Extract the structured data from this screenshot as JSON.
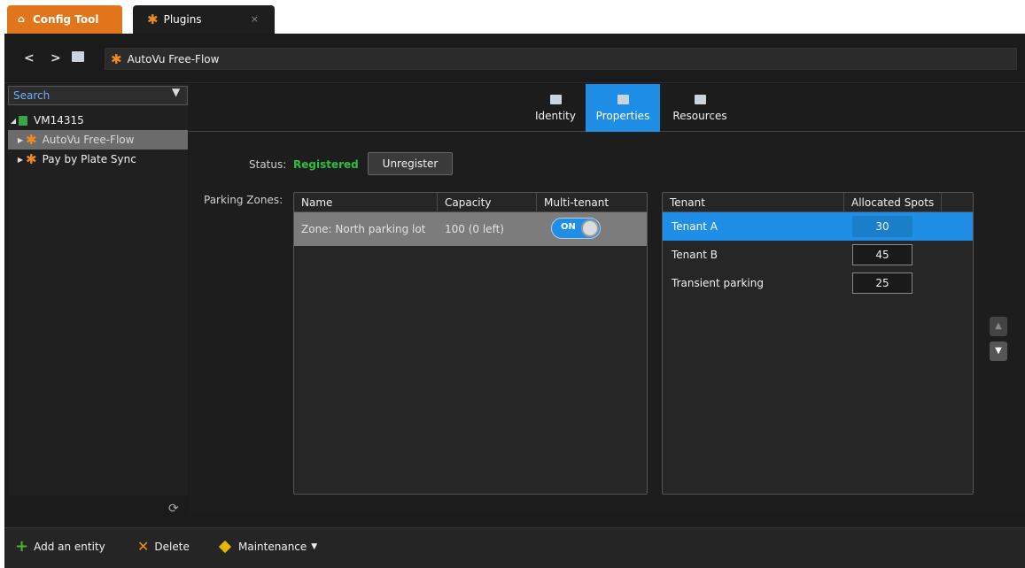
{
  "tabs": {
    "config_tool": "Config Tool",
    "plugins": "Plugins",
    "close": "×"
  },
  "nav": {
    "back": "<",
    "forward": ">",
    "address": "AutoVu Free-Flow"
  },
  "sidebar": {
    "search_placeholder": "Search",
    "tree": [
      {
        "label": "VM14315"
      },
      {
        "label": "AutoVu Free-Flow"
      },
      {
        "label": "Pay by Plate Sync"
      }
    ]
  },
  "content_tabs": [
    {
      "label": "Identity"
    },
    {
      "label": "Properties"
    },
    {
      "label": "Resources"
    }
  ],
  "status": {
    "label": "Status:",
    "value": "Registered",
    "unregister": "Unregister"
  },
  "parking": {
    "label": "Parking Zones:",
    "headers": [
      "Name",
      "Capacity",
      "Multi-tenant"
    ],
    "zone": {
      "name": "Zone: North parking lot",
      "capacity": "100 (0 left)",
      "multi_tenant": "ON"
    }
  },
  "tenants": {
    "headers": [
      "Tenant",
      "Allocated Spots"
    ],
    "rows": [
      {
        "name": "Tenant A",
        "spots": "30"
      },
      {
        "name": "Tenant B",
        "spots": "45"
      },
      {
        "name": "Transient parking",
        "spots": "25"
      }
    ]
  },
  "toolbar": {
    "add": "Add an entity",
    "delete": "Delete",
    "maintenance": "Maintenance"
  },
  "colors": {
    "accent": "#1e8ee6",
    "brand_orange": "#e0751c",
    "status_green": "#2fbf3f"
  }
}
